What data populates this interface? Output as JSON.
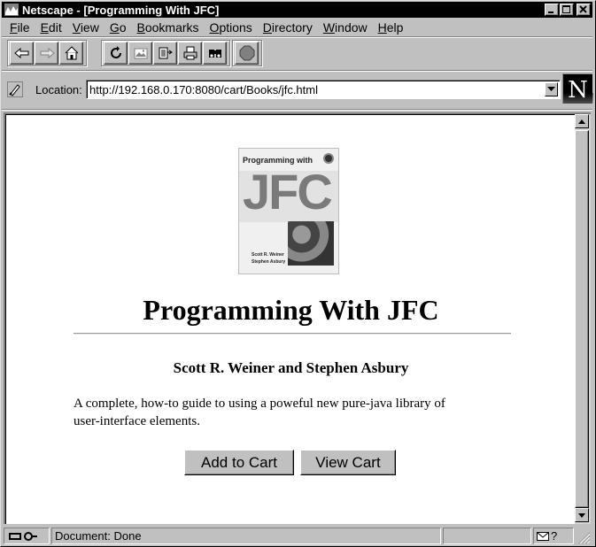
{
  "window": {
    "title": "Netscape - [Programming With JFC]"
  },
  "menu": {
    "items": [
      {
        "first": "F",
        "rest": "ile"
      },
      {
        "first": "E",
        "rest": "dit"
      },
      {
        "first": "V",
        "rest": "iew"
      },
      {
        "first": "G",
        "rest": "o"
      },
      {
        "first": "B",
        "rest": "ookmarks"
      },
      {
        "first": "O",
        "rest": "ptions"
      },
      {
        "first": "D",
        "rest": "irectory"
      },
      {
        "first": "W",
        "rest": "indow"
      },
      {
        "first": "H",
        "rest": "elp"
      }
    ]
  },
  "toolbar": {
    "icons": [
      "back-icon",
      "forward-icon",
      "home-icon",
      "reload-icon",
      "images-icon",
      "open-icon",
      "print-icon",
      "find-icon",
      "stop-icon"
    ]
  },
  "location": {
    "label": "Location:",
    "url": "http://192.168.0.170:8080/cart/Books/jfc.html"
  },
  "page": {
    "cover": {
      "top_text": "Programming with",
      "big_text": "JFC",
      "authors_line1": "Scott R. Weiner",
      "authors_line2": "Stephen Asbury"
    },
    "title": "Programming With JFC",
    "authors": "Scott R. Weiner and Stephen Asbury",
    "description": "A complete, how-to guide to using a poweful new pure-java library of user-interface elements.",
    "add_to_cart": "Add to Cart",
    "view_cart": "View Cart"
  },
  "status": {
    "text": "Document: Done",
    "mail_help": "?"
  }
}
